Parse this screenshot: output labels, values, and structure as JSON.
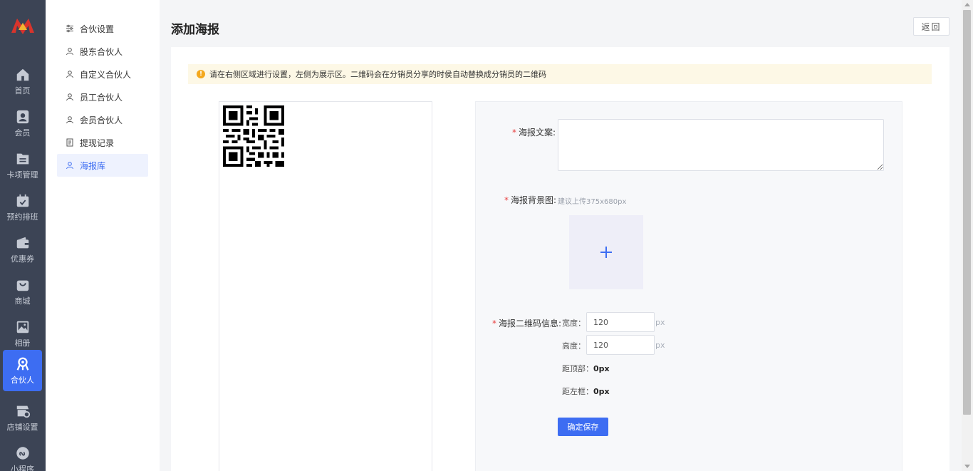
{
  "nav": {
    "items": [
      {
        "label": "首页",
        "icon": "home-icon"
      },
      {
        "label": "会员",
        "icon": "member-icon"
      },
      {
        "label": "卡项管理",
        "icon": "card-icon"
      },
      {
        "label": "预约排班",
        "icon": "calendar-icon"
      },
      {
        "label": "优惠券",
        "icon": "wallet-icon"
      },
      {
        "label": "商城",
        "icon": "bag-icon"
      },
      {
        "label": "相册",
        "icon": "image-icon"
      },
      {
        "label": "合伙人",
        "icon": "partner-icon",
        "active": true
      },
      {
        "label": "店铺设置",
        "icon": "store-settings-icon"
      },
      {
        "label": "小程序",
        "icon": "miniprogram-icon"
      }
    ]
  },
  "submenu": {
    "items": [
      {
        "label": "合伙设置",
        "icon": "sliders-icon"
      },
      {
        "label": "股东合伙人",
        "icon": "user-icon"
      },
      {
        "label": "自定义合伙人",
        "icon": "user-icon"
      },
      {
        "label": "员工合伙人",
        "icon": "user-icon"
      },
      {
        "label": "会员合伙人",
        "icon": "user-icon"
      },
      {
        "label": "提现记录",
        "icon": "document-icon"
      },
      {
        "label": "海报库",
        "icon": "user-icon",
        "active": true
      }
    ]
  },
  "header": {
    "title": "添加海报",
    "back_label": "返回"
  },
  "notice": {
    "text": "请在右侧区域进行设置，左侧为展示区。二维码会在分销员分享的时侯自动替换成分销员的二维码"
  },
  "form": {
    "copy_label": "海报文案:",
    "copy_value": "",
    "bg_label": "海报背景图:",
    "bg_hint": "建议上传375x680px",
    "qr_label": "海报二维码信息:",
    "width_label": "宽度：",
    "width_value": "120",
    "height_label": "高度：",
    "height_value": "120",
    "unit": "px",
    "top_label": "距顶部：",
    "top_value": "0px",
    "left_label": "距左框：",
    "left_value": "0px",
    "save_label": "确定保存"
  },
  "colors": {
    "accent": "#3d6df2",
    "rail_bg": "#3c4455",
    "notice_bg": "#fdf8e6",
    "required": "#e84040"
  }
}
